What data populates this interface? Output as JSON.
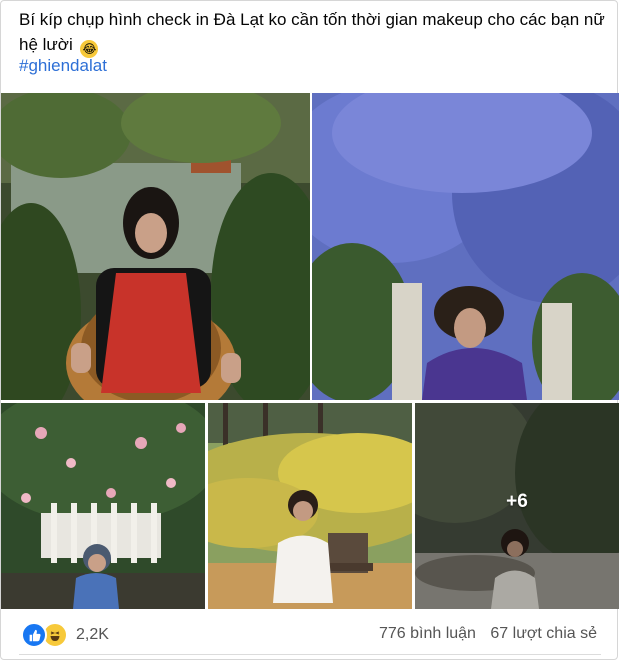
{
  "post": {
    "caption": "Bí kíp chụp hình check in Đà Lạt ko cần tốn thời gian makeup cho các bạn nữ hệ lười",
    "caption_emoji": "laughing-crying-emoji",
    "hashtag": "#ghiendalat"
  },
  "gallery": {
    "more_count": "+6",
    "photos": [
      {
        "name": "photo-girl-red-dress-wicker-chair"
      },
      {
        "name": "photo-blue-flower-wall"
      },
      {
        "name": "photo-pink-roses-fence"
      },
      {
        "name": "photo-yellow-flowers-bench"
      },
      {
        "name": "photo-waterfall-forest"
      }
    ]
  },
  "footer": {
    "reactions": [
      "like-icon",
      "haha-icon"
    ],
    "reaction_count": "2,2K",
    "comments": "776 bình luận",
    "shares": "67 lượt chia sẻ"
  },
  "colors": {
    "hashtag": "#2d6fd6",
    "like": "#1877f2",
    "haha": "#f7c93a",
    "meta_text": "#555555"
  }
}
